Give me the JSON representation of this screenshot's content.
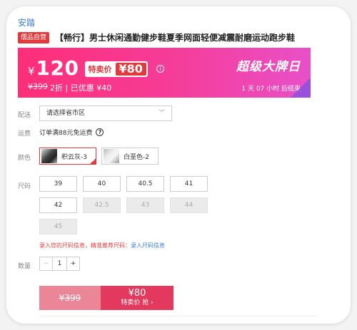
{
  "brand": "安踏",
  "header": {
    "badge": "儒品自营",
    "title": "【畅行】男士休闲通勤健步鞋夏季网面轻便减震耐磨运动跑步鞋"
  },
  "promo": {
    "currency": "¥",
    "price": "120",
    "special_label": "特卖价",
    "special_price": "¥80",
    "info_icon": "info-icon",
    "original_price": "¥399",
    "discount_text": "2折 | 已优惠 ¥40",
    "sale_title": "超级大牌日",
    "countdown": "1 天 07 小时 后结束",
    "gradient_start": "#ff2e78",
    "gradient_end": "#e850c8"
  },
  "delivery": {
    "label": "配送",
    "placeholder": "请选择省市区",
    "chevron_icon": "chevron-down-icon"
  },
  "shipping": {
    "label": "运费",
    "text": "订单满88元免运费",
    "help_icon": "question-icon"
  },
  "color": {
    "label": "颜色",
    "options": [
      {
        "name": "积云灰-3",
        "selected": true
      },
      {
        "name": "白垩色-2",
        "selected": false
      }
    ]
  },
  "size": {
    "label": "尺码",
    "options": [
      {
        "value": "39",
        "available": true
      },
      {
        "value": "40",
        "available": true
      },
      {
        "value": "40.5",
        "available": true
      },
      {
        "value": "41",
        "available": true
      },
      {
        "value": "42",
        "available": true
      },
      {
        "value": "42.5",
        "available": false
      },
      {
        "value": "43",
        "available": false
      },
      {
        "value": "44",
        "available": false
      },
      {
        "value": "45",
        "available": false
      }
    ],
    "hint": "录入您的尺码信息，精准推荐尺码：",
    "hint_link": "录入尺码信息"
  },
  "quantity": {
    "label": "数量",
    "minus": "−",
    "value": "1",
    "plus": "+"
  },
  "buy": {
    "original_price": "¥399",
    "price": "¥80",
    "action": "特卖价 抢 ›"
  },
  "colors": {
    "accent": "#e4393c",
    "link": "#3a7bd5",
    "buy_left": "#eb8598",
    "buy_right": "#e4395f"
  }
}
